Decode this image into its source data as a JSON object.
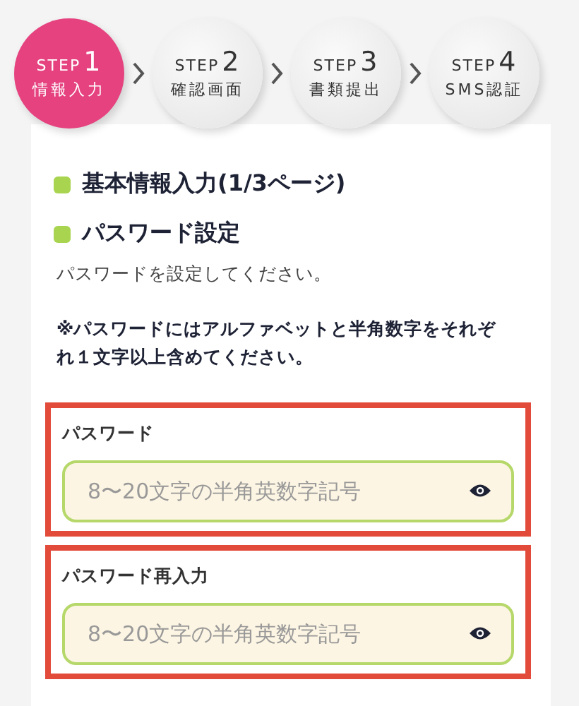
{
  "steps": [
    {
      "label": "STEP",
      "number": "1",
      "name": "情報入力",
      "selected": true
    },
    {
      "label": "STEP",
      "number": "2",
      "name": "確認画面",
      "selected": false
    },
    {
      "label": "STEP",
      "number": "3",
      "name": "書類提出",
      "selected": false
    },
    {
      "label": "STEP",
      "number": "4",
      "name": "SMS認証",
      "selected": false
    }
  ],
  "headings": [
    "基本情報入力(1/3ページ)",
    "パスワード設定"
  ],
  "description": "パスワードを設定してください。",
  "note": "※パスワードにはアルファベットと半角数字をそれぞれ１文字以上含めてください。",
  "fields": [
    {
      "label": "パスワード",
      "placeholder": "8〜20文字の半角英数字記号",
      "highlighted": true
    },
    {
      "label": "パスワード再入力",
      "placeholder": "8〜20文字の半角英数字記号",
      "highlighted": true
    }
  ]
}
